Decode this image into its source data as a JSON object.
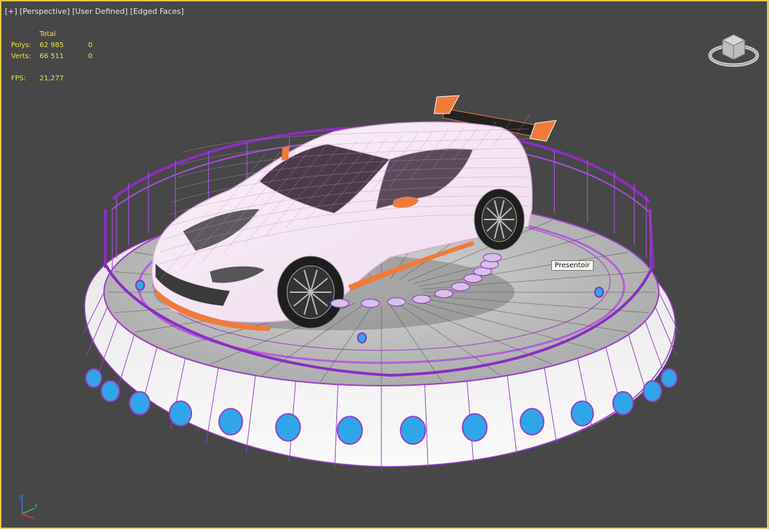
{
  "viewport": {
    "labels": {
      "plus": "[+]",
      "view": "[Perspective]",
      "camera": "[User Defined]",
      "shading": "[Edged Faces]"
    },
    "stats": {
      "header": "Total",
      "polys_label": "Polys:",
      "polys_total": "62 985",
      "polys_selected": "0",
      "verts_label": "Verts:",
      "verts_total": "66 511",
      "verts_selected": "0",
      "fps_label": "FPS:",
      "fps_value": "21,277"
    },
    "tooltip": "Presentoir",
    "colors": {
      "background": "#474747",
      "border_active": "#e8c84a",
      "stats_text": "#f2e24a",
      "wire_purple": "#9a3ec8",
      "car_body": "#f4e6f2",
      "accent_orange": "#f07a3a",
      "light_blue": "#2fa6e8"
    },
    "icons": {
      "viewcube": "viewcube-icon",
      "axis_tripod": "axis-tripod-icon"
    }
  }
}
